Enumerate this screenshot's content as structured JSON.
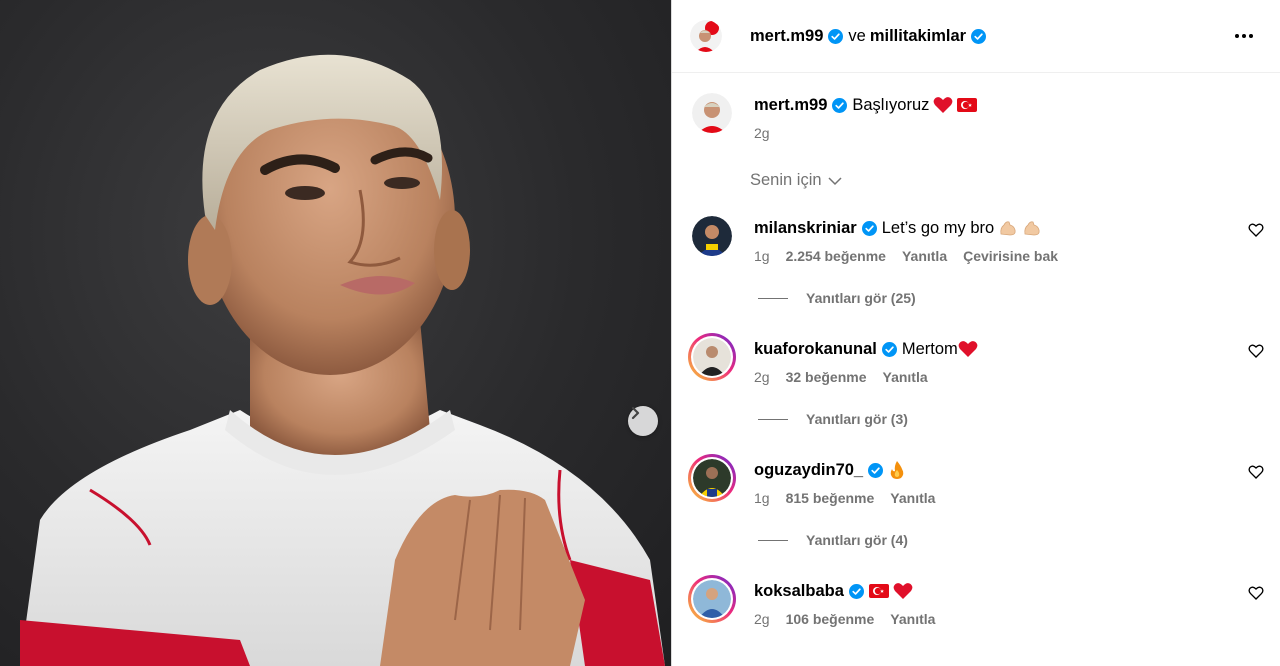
{
  "header": {
    "user1": "mert.m99",
    "conjunction": "ve",
    "user2": "millitakimlar"
  },
  "caption": {
    "user": "mert.m99",
    "text": "Başlıyoruz",
    "time": "2g"
  },
  "filter": {
    "label": "Senin için"
  },
  "comments": [
    {
      "user": "milanskriniar",
      "text": "Let’s go my bro",
      "time": "1g",
      "likes": "2.254 beğenme",
      "reply": "Yanıtla",
      "translate": "Çevirisine bak",
      "replies": "Yanıtları gör (25)"
    },
    {
      "user": "kuaforokanunal",
      "text": "Mertom",
      "time": "2g",
      "likes": "32 beğenme",
      "reply": "Yanıtla",
      "replies": "Yanıtları gör (3)"
    },
    {
      "user": "oguzaydin70_",
      "text": "",
      "time": "1g",
      "likes": "815 beğenme",
      "reply": "Yanıtla",
      "replies": "Yanıtları gör (4)"
    },
    {
      "user": "koksalbaba",
      "text": "",
      "time": "2g",
      "likes": "106 beğenme",
      "reply": "Yanıtla"
    }
  ],
  "colors": {
    "verified": "#0095f6",
    "heart_red": "#e0102a",
    "flag_red": "#e30a17",
    "muted_text": "#737373",
    "photo_bg": "#2a2a2c"
  },
  "icons": [
    "next-arrow-icon",
    "more-options-icon",
    "verified-badge-icon",
    "heart-icon",
    "chevron-down-icon",
    "turkey-flag-icon",
    "flexed-biceps-icon",
    "fire-icon",
    "red-heart-icon"
  ]
}
